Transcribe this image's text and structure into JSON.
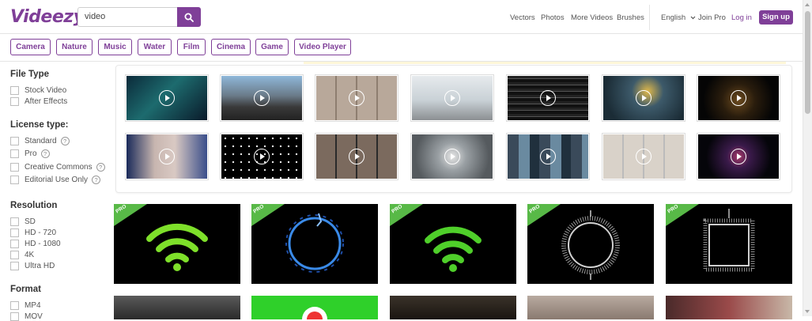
{
  "header": {
    "logo": "Videezy",
    "search_value": "video",
    "nav": [
      "Vectors",
      "Photos",
      "More Videos",
      "Brushes",
      "English",
      "Join Pro",
      "Log in"
    ],
    "signup_label": "Sign up",
    "accent_color": "#7f3f98"
  },
  "chips": [
    "Camera",
    "Nature",
    "Music",
    "Water",
    "Film",
    "Cinema",
    "Game",
    "Video Player"
  ],
  "sidebar": {
    "file_type": {
      "title": "File Type",
      "options": [
        "Stock Video",
        "After Effects"
      ]
    },
    "license": {
      "title": "License type:",
      "options": [
        "Standard",
        "Pro",
        "Creative Commons",
        "Editorial Use Only"
      ]
    },
    "resolution": {
      "title": "Resolution",
      "options": [
        "SD",
        "HD - 720",
        "HD - 1080",
        "4K",
        "Ultra HD"
      ]
    },
    "format": {
      "title": "Format",
      "options": [
        "MP4",
        "MOV"
      ]
    }
  },
  "results": {
    "pro_label": "PRO",
    "pro_badge_color": "#58b947"
  }
}
